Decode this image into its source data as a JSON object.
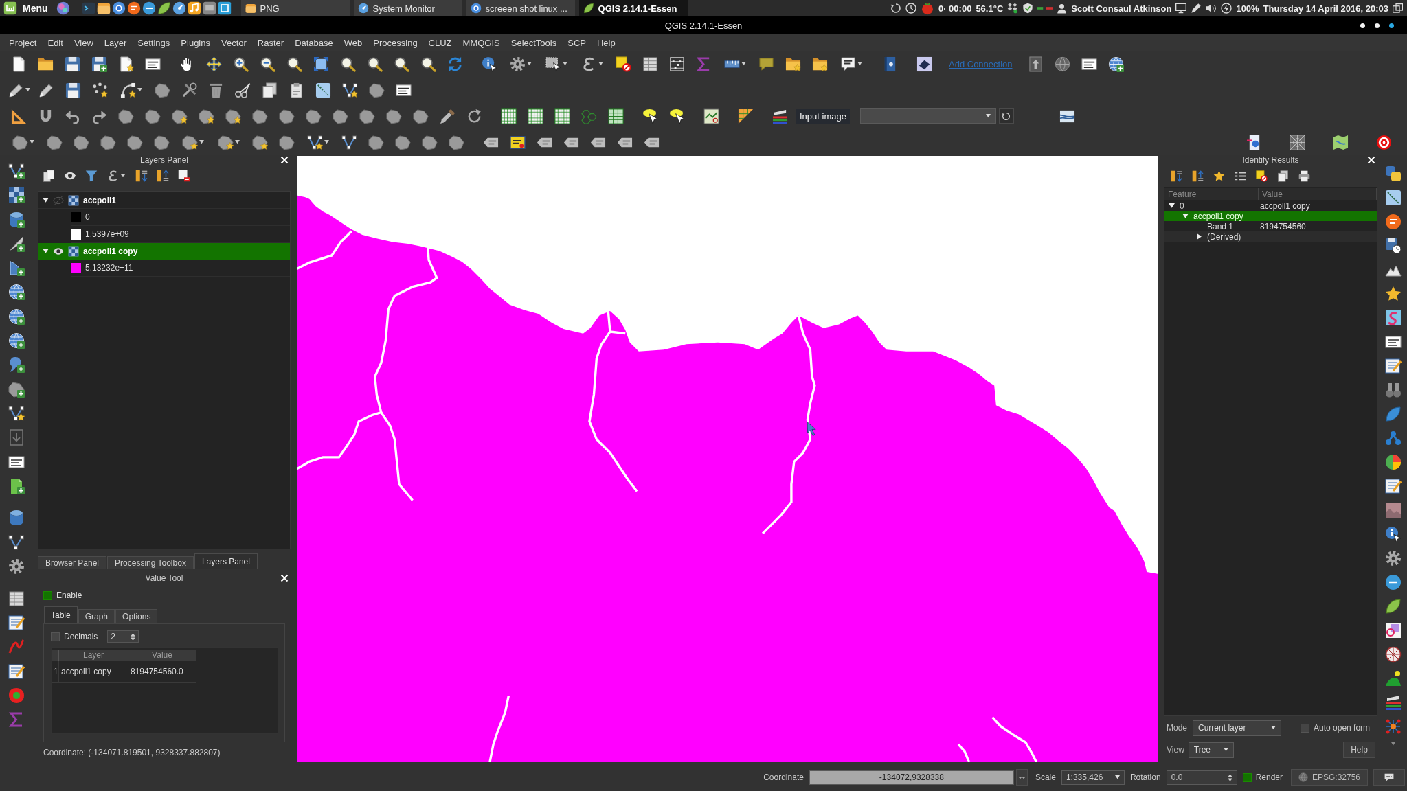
{
  "taskbar": {
    "menu_label": "Menu",
    "windows": [
      {
        "label": "PNG",
        "selected": false
      },
      {
        "label": "System Monitor",
        "selected": false
      },
      {
        "label": "screeen shot linux ...",
        "selected": false
      },
      {
        "label": "QGIS 2.14.1-Essen",
        "selected": true
      }
    ],
    "tray": {
      "timer": "0· 00:00",
      "temperature": "56.1°C",
      "user": "Scott Consaul Atkinson",
      "battery": "100%",
      "clock": "Thursday 14 April 2016, 20:03"
    }
  },
  "window": {
    "title": "QGIS 2.14.1-Essen"
  },
  "menu": [
    "Project",
    "Edit",
    "View",
    "Layer",
    "Settings",
    "Plugins",
    "Vector",
    "Raster",
    "Database",
    "Web",
    "Processing",
    "CLUZ",
    "MMQGIS",
    "SelectTools",
    "SCP",
    "Help"
  ],
  "toolbar": {
    "link": "Add Connection",
    "input_label": "Input image"
  },
  "layers_panel": {
    "title": "Layers Panel",
    "layers": [
      {
        "name": "accpoll1",
        "visible": false,
        "expanded": true,
        "selected": false,
        "legend": [
          {
            "label": "0",
            "color": "#000000"
          },
          {
            "label": "1.5397e+09",
            "color": "#ffffff"
          }
        ]
      },
      {
        "name": "accpoll1 copy",
        "visible": true,
        "expanded": true,
        "selected": true,
        "legend": [
          {
            "label": "5.13232e+11",
            "color": "#ff00ff"
          }
        ]
      }
    ]
  },
  "dock_tabs": [
    {
      "label": "Browser Panel",
      "selected": false
    },
    {
      "label": "Processing Toolbox",
      "selected": false
    },
    {
      "label": "Layers Panel",
      "selected": true
    }
  ],
  "value_tool": {
    "title": "Value Tool",
    "enable": {
      "label": "Enable",
      "checked": true
    },
    "tabs": [
      {
        "label": "Table",
        "selected": true
      },
      {
        "label": "Graph",
        "selected": false
      },
      {
        "label": "Options",
        "selected": false
      }
    ],
    "decimals": {
      "label": "Decimals",
      "checked": false,
      "value": "2"
    },
    "table": {
      "columns": [
        "Layer",
        "Value"
      ],
      "rows": [
        {
          "number": "1",
          "cells": [
            "accpoll1 copy",
            "8194754560.0"
          ]
        }
      ]
    },
    "coordinate": "Coordinate: (-134071.819501, 9328337.882807)"
  },
  "identify_results": {
    "title": "Identify Results",
    "columns": [
      "Feature",
      "Value"
    ],
    "tree": [
      {
        "feature": "0",
        "value": "accpoll1 copy",
        "expanded": true,
        "selected": false,
        "children": [
          {
            "feature": "accpoll1 copy",
            "expanded": true,
            "selected": true,
            "children": [
              {
                "feature": "Band 1",
                "value": "8194754560",
                "selected": false
              },
              {
                "feature": "(Derived)",
                "expanded": false,
                "selected": false
              }
            ]
          }
        ]
      }
    ],
    "mode": {
      "label": "Mode",
      "value": "Current layer"
    },
    "auto_open": {
      "label": "Auto open form",
      "checked": false
    },
    "view": {
      "label": "View",
      "value": "Tree"
    },
    "help": "Help"
  },
  "status_bar": {
    "coordinate_label": "Coordinate",
    "coordinate": "-134072,9328338",
    "scale_label": "Scale",
    "scale": "1:335,426",
    "rotation_label": "Rotation",
    "rotation": "0.0",
    "render": {
      "label": "Render",
      "checked": true
    },
    "crs": "EPSG:32756"
  }
}
